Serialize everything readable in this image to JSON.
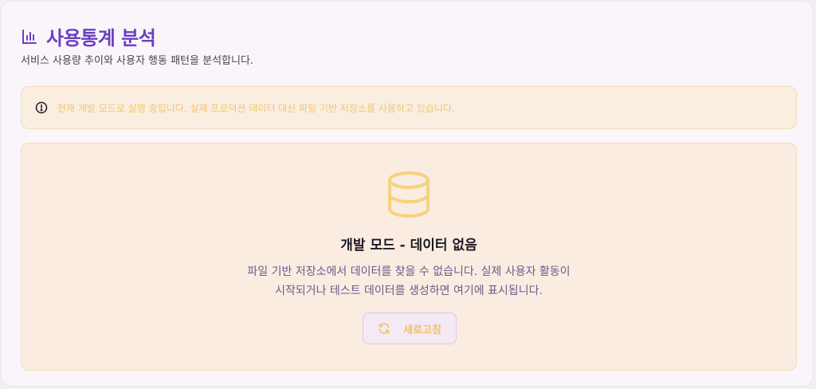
{
  "header": {
    "icon": "bar-chart-icon",
    "title": "사용통계 분석",
    "subtitle": "서비스 사용량 추이와 사용자 행동 패턴을 분석합니다."
  },
  "alert": {
    "icon": "alert-circle-icon",
    "text": "현재 개발 모드로 실행 중입니다. 실제 프로덕션 데이터 대신 파일 기반 저장소를 사용하고 있습니다."
  },
  "empty_state": {
    "icon": "database-icon",
    "title": "개발 모드 - 데이터 없음",
    "description_line1": "파일 기반 저장소에서 데이터를 찾을 수 없습니다. 실제 사용자 활동이",
    "description_line2": "시작되거나 테스트 데이터를 생성하면 여기에 표시됩니다.",
    "refresh_button": {
      "icon": "refresh-icon",
      "label": "새로고침"
    }
  },
  "colors": {
    "title": "#6b3fc1",
    "warning": "#f1c86f",
    "panel_bg": "#faf5fb",
    "empty_bg": "#faece1"
  }
}
